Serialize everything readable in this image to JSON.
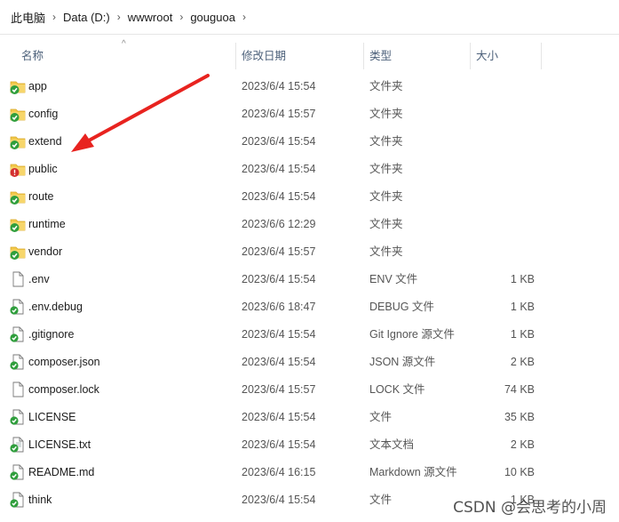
{
  "breadcrumb": [
    "此电脑",
    "Data (D:)",
    "wwwroot",
    "gouguoa"
  ],
  "columns": {
    "name": "名称",
    "date": "修改日期",
    "type": "类型",
    "size": "大小"
  },
  "files": [
    {
      "name": "app",
      "date": "2023/6/4 15:54",
      "type": "文件夹",
      "size": "",
      "icon": "folder-synced-icon"
    },
    {
      "name": "config",
      "date": "2023/6/4 15:57",
      "type": "文件夹",
      "size": "",
      "icon": "folder-synced-icon"
    },
    {
      "name": "extend",
      "date": "2023/6/4 15:54",
      "type": "文件夹",
      "size": "",
      "icon": "folder-synced-icon"
    },
    {
      "name": "public",
      "date": "2023/6/4 15:54",
      "type": "文件夹",
      "size": "",
      "icon": "folder-error-icon"
    },
    {
      "name": "route",
      "date": "2023/6/4 15:54",
      "type": "文件夹",
      "size": "",
      "icon": "folder-synced-icon"
    },
    {
      "name": "runtime",
      "date": "2023/6/6 12:29",
      "type": "文件夹",
      "size": "",
      "icon": "folder-synced-icon"
    },
    {
      "name": "vendor",
      "date": "2023/6/4 15:57",
      "type": "文件夹",
      "size": "",
      "icon": "folder-synced-icon"
    },
    {
      "name": ".env",
      "date": "2023/6/4 15:54",
      "type": "ENV 文件",
      "size": "1 KB",
      "icon": "file-icon"
    },
    {
      "name": ".env.debug",
      "date": "2023/6/6 18:47",
      "type": "DEBUG 文件",
      "size": "1 KB",
      "icon": "file-synced-icon"
    },
    {
      "name": ".gitignore",
      "date": "2023/6/4 15:54",
      "type": "Git Ignore 源文件",
      "size": "1 KB",
      "icon": "file-synced-icon"
    },
    {
      "name": "composer.json",
      "date": "2023/6/4 15:54",
      "type": "JSON 源文件",
      "size": "2 KB",
      "icon": "file-synced-icon"
    },
    {
      "name": "composer.lock",
      "date": "2023/6/4 15:57",
      "type": "LOCK 文件",
      "size": "74 KB",
      "icon": "file-icon"
    },
    {
      "name": "LICENSE",
      "date": "2023/6/4 15:54",
      "type": "文件",
      "size": "35 KB",
      "icon": "file-synced-icon"
    },
    {
      "name": "LICENSE.txt",
      "date": "2023/6/4 15:54",
      "type": "文本文档",
      "size": "2 KB",
      "icon": "textfile-synced-icon"
    },
    {
      "name": "README.md",
      "date": "2023/6/4 16:15",
      "type": "Markdown 源文件",
      "size": "10 KB",
      "icon": "file-synced-icon"
    },
    {
      "name": "think",
      "date": "2023/6/4 15:54",
      "type": "文件",
      "size": "1 KB",
      "icon": "file-synced-icon"
    }
  ],
  "watermark": "CSDN @会思考的小周",
  "colors": {
    "arrow": "#e8231f",
    "folder": "#f2c94c",
    "sync_ok": "#2f9e3c",
    "sync_error": "#d32f2f"
  }
}
